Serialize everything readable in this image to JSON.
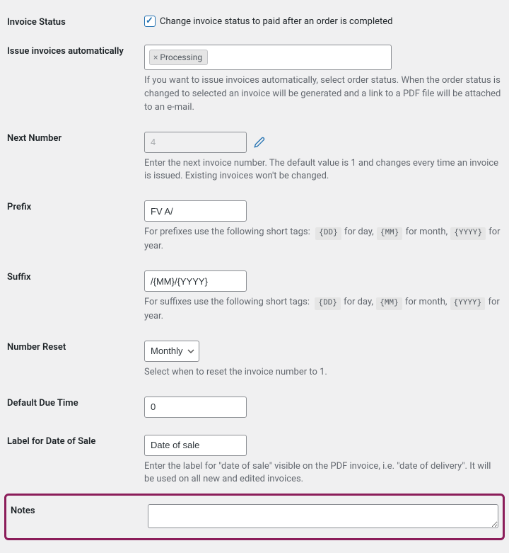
{
  "invoiceStatus": {
    "label": "Invoice Status",
    "checkboxLabel": "Change invoice status to paid after an order is completed",
    "checked": true
  },
  "issueAuto": {
    "label": "Issue invoices automatically",
    "tags": [
      {
        "text": "Processing"
      }
    ],
    "desc": "If you want to issue invoices automatically, select order status. When the order status is changed to selected an invoice will be generated and a link to a PDF file will be attached to an e-mail."
  },
  "nextNumber": {
    "label": "Next Number",
    "value": "4",
    "desc": "Enter the next invoice number. The default value is 1 and changes every time an invoice is issued. Existing invoices won't be changed."
  },
  "prefix": {
    "label": "Prefix",
    "value": "FV A/",
    "descStart": "For prefixes use the following short tags:",
    "tagDay": "{DD}",
    "postDay": " for day, ",
    "tagMonth": "{MM}",
    "postMonth": " for month, ",
    "tagYear": "{YYYY}",
    "postYear": " for year."
  },
  "suffix": {
    "label": "Suffix",
    "value": "/{MM}/{YYYY}",
    "descStart": "For suffixes use the following short tags:",
    "tagDay": "{DD}",
    "postDay": " for day, ",
    "tagMonth": "{MM}",
    "postMonth": " for month, ",
    "tagYear": "{YYYY}",
    "postYear": " for year."
  },
  "numberReset": {
    "label": "Number Reset",
    "value": "Monthly",
    "desc": "Select when to reset the invoice number to 1."
  },
  "defaultDue": {
    "label": "Default Due Time",
    "value": "0"
  },
  "dateSaleLabel": {
    "label": "Label for Date of Sale",
    "value": "Date of sale",
    "desc": "Enter the label for \"date of sale\" visible on the PDF invoice, i.e. \"date of delivery\". It will be used on all new and edited invoices."
  },
  "notes": {
    "label": "Notes",
    "value": ""
  }
}
